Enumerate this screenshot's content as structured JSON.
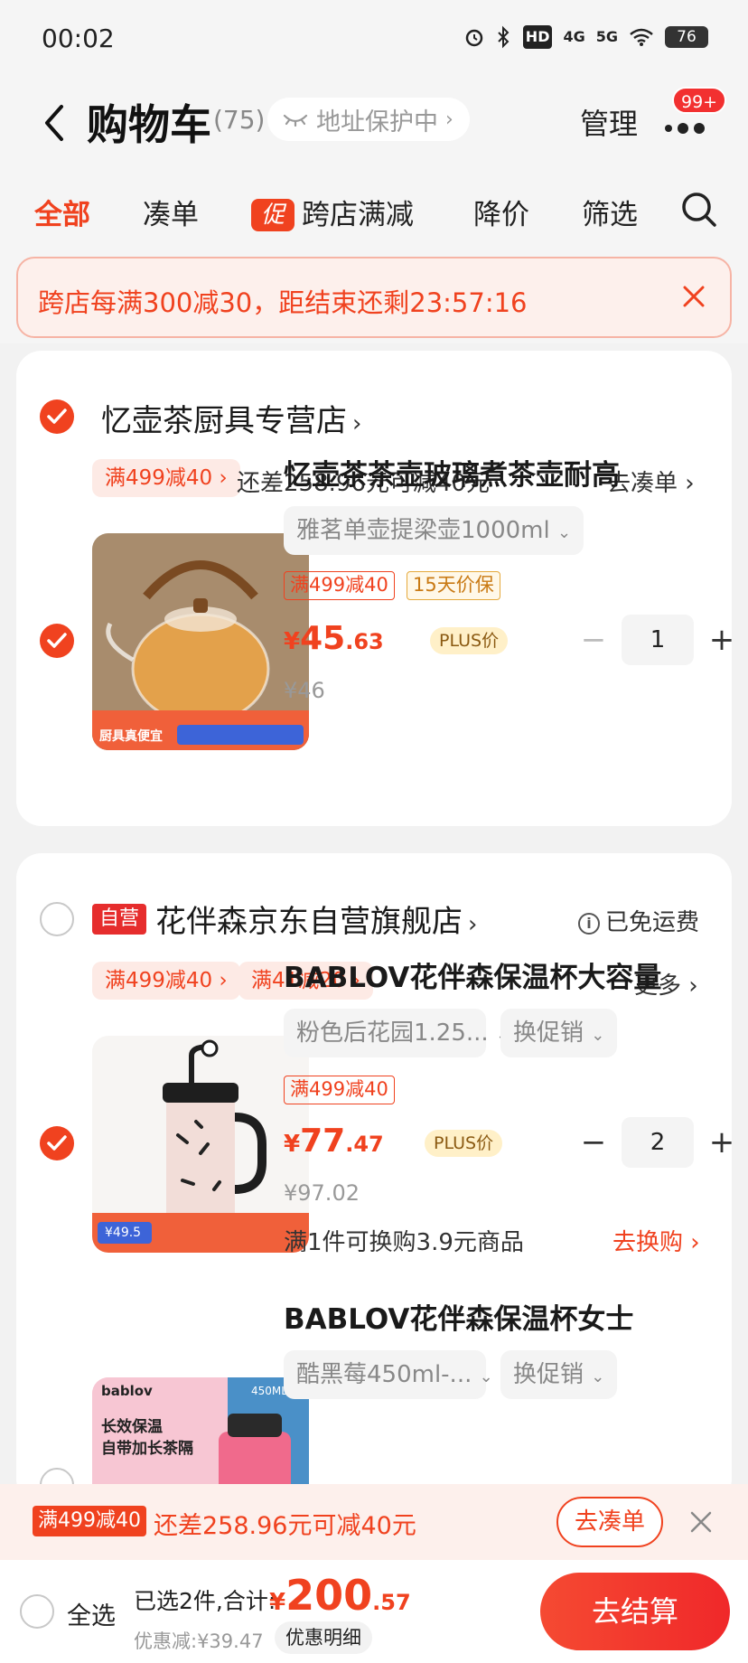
{
  "status_bar": {
    "time": "00:02",
    "network_a": "4G",
    "network_b": "5G",
    "hd": "HD",
    "battery": "76"
  },
  "header": {
    "title": "购物车",
    "count": "(75)",
    "address_label": "地址保护中",
    "manage": "管理",
    "badge": "99+"
  },
  "tabs": [
    {
      "label": "全部"
    },
    {
      "label": "凑单"
    },
    {
      "label": "跨店满减",
      "promo_tag": "促"
    },
    {
      "label": "降价"
    },
    {
      "label": "筛选"
    }
  ],
  "banner": {
    "text": "跨店每满300减30，距结束还剩23:57:16"
  },
  "shops": [
    {
      "name": "忆壶茶厨具专营店",
      "promos": [
        "满499减40"
      ],
      "note": "还差258.96元可减40元",
      "action": "去凑单",
      "items": [
        {
          "title": "忆壶茶茶壶玻璃煮茶壶耐高",
          "spec": "雅茗单壶提梁壶1000ml",
          "tags": [
            "满499减40",
            "15天价保"
          ],
          "price_yen": "¥",
          "price_int": "45",
          "price_dec": ".63",
          "plus_tag": "PLUS价",
          "orig_price": "¥46",
          "qty": "1",
          "checked": true,
          "image_banner": "厨具真便宜"
        }
      ]
    },
    {
      "name": "花伴森京东自营旗舰店",
      "self_tag": "自营",
      "shipping": "已免运费",
      "promos": [
        "满499减40",
        "满41减20"
      ],
      "action": "更多",
      "items": [
        {
          "title": "BABLOV花伴森保温杯大容量",
          "spec": "粉色后花园1.25...",
          "spec2": "换促销",
          "tags": [
            "满499减40"
          ],
          "price_yen": "¥",
          "price_int": "77",
          "price_dec": ".47",
          "plus_tag": "PLUS价",
          "orig_price": "¥97.02",
          "qty": "2",
          "checked": true,
          "swap_text": "满1件可换购3.9元商品",
          "swap_link": "去换购",
          "image_badge": "¥49.5"
        },
        {
          "title": "BABLOV花伴森保温杯女士",
          "spec": "酷黑莓450ml-...",
          "spec2": "换促销",
          "checked": false,
          "image_brand": "bablov",
          "image_line1": "长效保温",
          "image_line2": "自带加长茶隔",
          "image_size": "450ML"
        }
      ]
    }
  ],
  "promo_bar": {
    "tag": "满499减40",
    "text": "还差258.96元可减40元",
    "button": "去凑单"
  },
  "checkout": {
    "select_all": "全选",
    "selected": "已选2件,合计:",
    "total_yen": "¥",
    "total_int": "200",
    "total_dec": ".57",
    "discount": "优惠减:¥39.47",
    "detail": "优惠明细",
    "button": "去结算"
  },
  "colors": {
    "accent": "#f0421f",
    "background": "#f2f2f2"
  }
}
